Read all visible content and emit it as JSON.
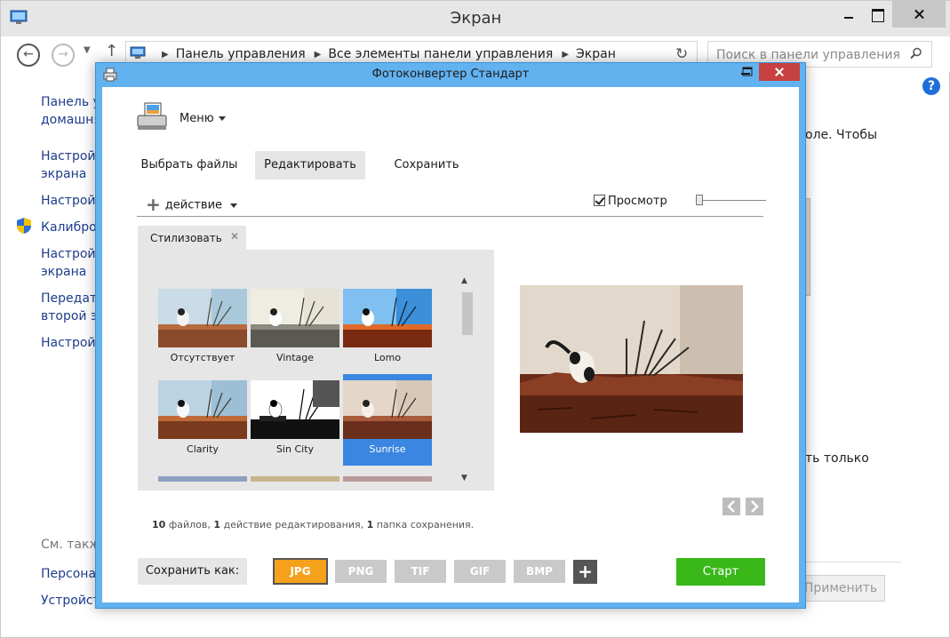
{
  "control_panel": {
    "title": "Экран",
    "breadcrumbs": [
      "Панель управления",
      "Все элементы панели управления",
      "Экран"
    ],
    "search_placeholder": "Поиск в панели управления",
    "sidebar": [
      "Панель у",
      "домашня",
      "Настрой",
      "экрана",
      "Настрой",
      "Калибро",
      "Настрой",
      "экрана",
      "Передат",
      "второй э",
      "Настрой"
    ],
    "see_also": "См. такж",
    "see_also_items": [
      "Персона",
      "Устройст"
    ],
    "right_text_1": "оле. Чтобы",
    "right_text_2": "ть только",
    "apply_label": "Применить"
  },
  "photo_converter": {
    "title": "Фотоконвертер Стандарт",
    "menu_label": "Меню",
    "tabs": [
      {
        "label": "Выбрать файлы",
        "active": false
      },
      {
        "label": "Редактировать",
        "active": true
      },
      {
        "label": "Сохранить",
        "active": false
      }
    ],
    "action_label": "действие",
    "preview_label": "Просмотр",
    "preview_checked": true,
    "style_tab_label": "Стилизовать",
    "styles": [
      {
        "name": "Отсутствует",
        "selected": false
      },
      {
        "name": "Vintage",
        "selected": false
      },
      {
        "name": "Lomo",
        "selected": false
      },
      {
        "name": "Clarity",
        "selected": false
      },
      {
        "name": "Sin City",
        "selected": false
      },
      {
        "name": "Sunrise",
        "selected": true
      }
    ],
    "status": {
      "files_count": "10",
      "files_text": "файлов,",
      "actions_count": "1",
      "actions_text": "действие редактирования,",
      "folders_count": "1",
      "folders_text": "папка сохранения."
    },
    "save_as_label": "Сохранить как:",
    "formats": [
      {
        "label": "JPG",
        "active": true
      },
      {
        "label": "PNG",
        "active": false
      },
      {
        "label": "TIF",
        "active": false
      },
      {
        "label": "GIF",
        "active": false
      },
      {
        "label": "BMP",
        "active": false
      }
    ],
    "add_format_label": "+",
    "start_label": "Старт",
    "colors": {
      "title_bar": "#62b2f0",
      "active_format": "#f5a11c",
      "start_button": "#3ab81a",
      "selected_style": "#3a86e0",
      "close_button": "#c74141"
    }
  }
}
